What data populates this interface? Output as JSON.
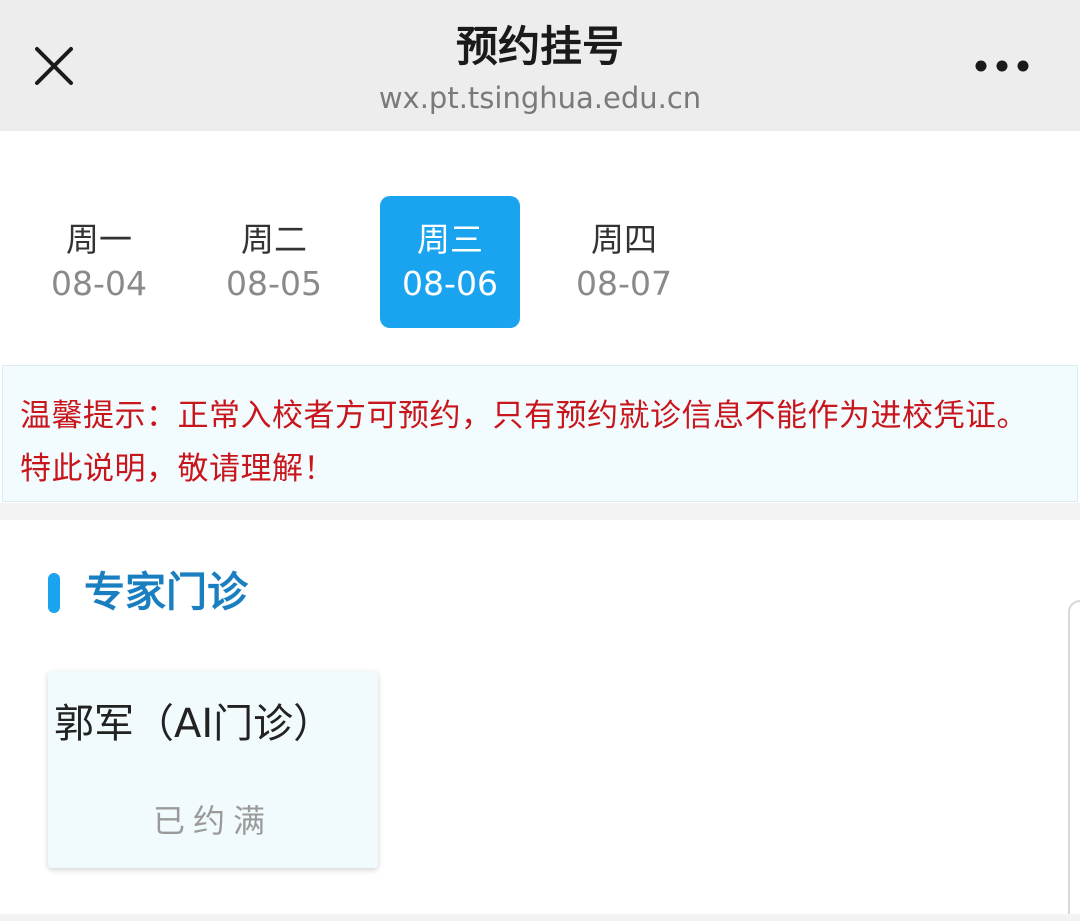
{
  "header": {
    "title": "预约挂号",
    "url": "wx.pt.tsinghua.edu.cn"
  },
  "icons": {
    "close": "close-icon",
    "more": "more-dots-icon"
  },
  "dates": [
    {
      "weekday": "周一",
      "date": "08-04",
      "selected": false
    },
    {
      "weekday": "周二",
      "date": "08-05",
      "selected": false
    },
    {
      "weekday": "周三",
      "date": "08-06",
      "selected": true
    },
    {
      "weekday": "周四",
      "date": "08-07",
      "selected": false
    }
  ],
  "notice": {
    "text": "温馨提示：正常入校者方可预约，只有预约就诊信息不能作为进校凭证。特此说明，敬请理解！"
  },
  "section": {
    "title": "专家门诊"
  },
  "doctors": [
    {
      "name": "郭军（AI门诊）",
      "status": "已约满"
    }
  ],
  "colors": {
    "accent": "#1aa4ef",
    "section_title": "#1a7fc1",
    "notice_text": "#c8161d",
    "header_bg": "#ededed"
  }
}
